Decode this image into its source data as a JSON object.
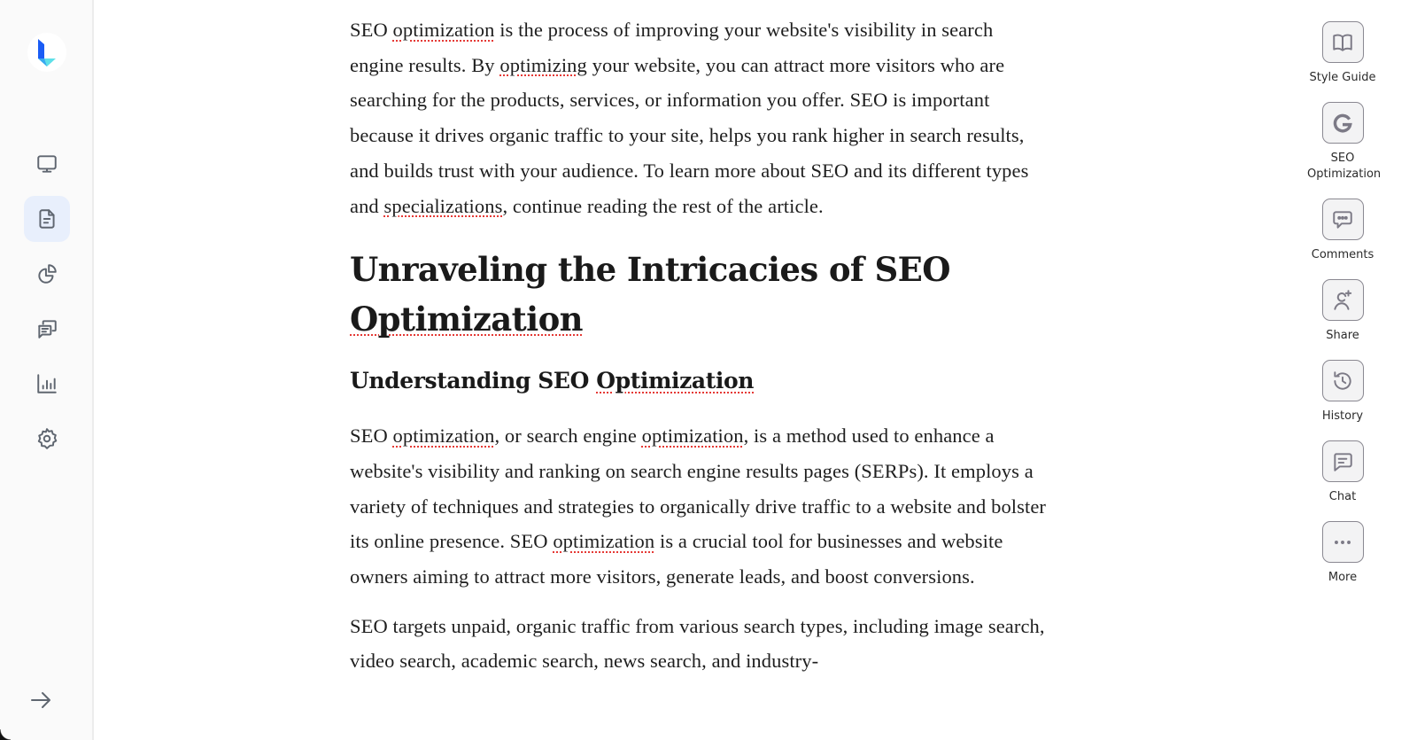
{
  "colors": {
    "accent": "#1a5cf5",
    "accent_light": "#5ee0e8",
    "active_nav_bg": "#e8effc",
    "icon_gray": "#5f6670",
    "tool_icon": "#7c7a86",
    "spellcheck": "#e53935"
  },
  "sidebar": {
    "logo": "brand-logo",
    "items": [
      {
        "name": "monitor",
        "icon": "monitor-icon",
        "active": false
      },
      {
        "name": "documents",
        "icon": "document-icon",
        "active": true
      },
      {
        "name": "analytics-pie",
        "icon": "pie-chart-icon",
        "active": false
      },
      {
        "name": "conversations",
        "icon": "chat-bubbles-icon",
        "active": false
      },
      {
        "name": "reports",
        "icon": "bar-chart-icon",
        "active": false
      },
      {
        "name": "settings",
        "icon": "gear-icon",
        "active": false
      }
    ],
    "expand_icon": "arrow-right-icon"
  },
  "document": {
    "intro_paragraph": [
      {
        "t": "SEO "
      },
      {
        "t": "optimization",
        "spell": true
      },
      {
        "t": " is the process of improving your website's visibility in search engine results. By "
      },
      {
        "t": "optimizing",
        "spell": true
      },
      {
        "t": " your website, you can attract more visitors who are searching for the products, services, or information you offer. SEO is important because it drives organic traffic to your site, helps you rank higher in search results, and builds trust with your audience. To learn more about SEO and its different types and "
      },
      {
        "t": "specializations",
        "spell": true
      },
      {
        "t": ", continue reading the rest of the article."
      }
    ],
    "heading1": [
      {
        "t": "Unraveling the Intricacies of SEO "
      },
      {
        "t": "Optimization",
        "spell": true
      }
    ],
    "heading2": [
      {
        "t": "Understanding SEO "
      },
      {
        "t": "Optimization",
        "spell": true
      }
    ],
    "paragraph2": [
      {
        "t": "SEO "
      },
      {
        "t": "optimization",
        "spell": true
      },
      {
        "t": ", or search engine "
      },
      {
        "t": "optimization",
        "spell": true
      },
      {
        "t": ", is a method used to enhance a website's visibility and ranking on search engine results pages (SERPs). It employs a variety of techniques and strategies to organically drive traffic to a website and bolster its online presence. SEO "
      },
      {
        "t": "optimization",
        "spell": true
      },
      {
        "t": " is a crucial tool for businesses and website owners aiming to attract more visitors, generate leads, and boost conversions."
      }
    ],
    "paragraph3": [
      {
        "t": "SEO targets unpaid, organic traffic from various search types, including image search, video search, academic search, news search, and industry-"
      }
    ]
  },
  "tools": [
    {
      "label": "Style Guide",
      "icon": "book-icon"
    },
    {
      "label": "SEO Optimization",
      "icon": "google-icon"
    },
    {
      "label": "Comments",
      "icon": "comment-icon"
    },
    {
      "label": "Share",
      "icon": "add-user-icon"
    },
    {
      "label": "History",
      "icon": "history-icon"
    },
    {
      "label": "Chat",
      "icon": "chat-icon"
    },
    {
      "label": "More",
      "icon": "more-icon"
    }
  ]
}
